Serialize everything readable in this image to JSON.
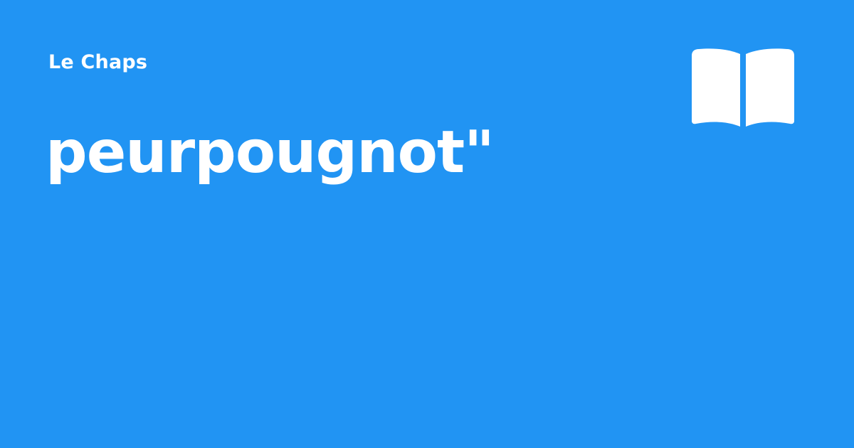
{
  "site": {
    "name": "Le Chaps"
  },
  "entry": {
    "title": "peurpougnot\""
  },
  "theme": {
    "background": "#2194f3",
    "foreground": "#ffffff"
  },
  "logo": {
    "icon": "open-book-icon"
  }
}
